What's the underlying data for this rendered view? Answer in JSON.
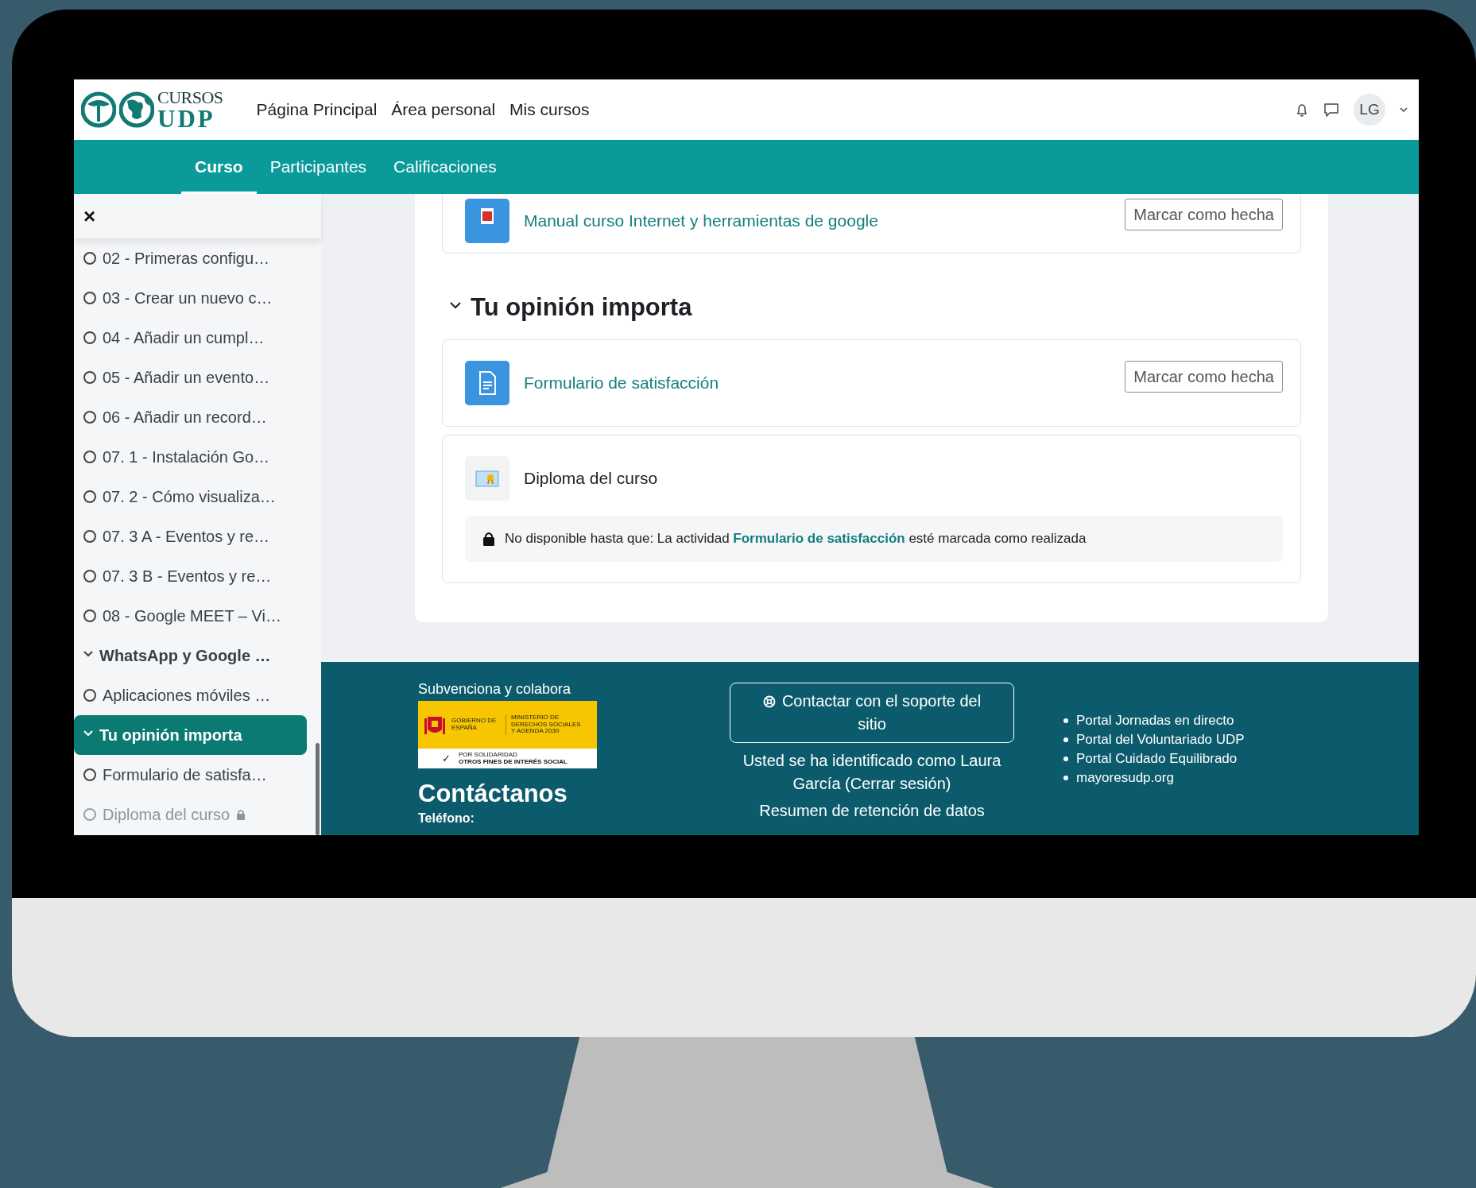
{
  "header": {
    "logo": {
      "line1": "CURSOS",
      "line2": "UDP"
    },
    "nav": [
      {
        "label": "Página Principal"
      },
      {
        "label": "Área personal"
      },
      {
        "label": "Mis cursos"
      }
    ],
    "avatar": "LG"
  },
  "tabs": [
    {
      "label": "Curso",
      "selected": true
    },
    {
      "label": "Participantes",
      "selected": false
    },
    {
      "label": "Calificaciones",
      "selected": false
    }
  ],
  "sidebar": {
    "close": "×",
    "items": [
      {
        "kind": "activity",
        "label": "02 - Primeras configu…",
        "selected": false,
        "disabled": false
      },
      {
        "kind": "activity",
        "label": "03 - Crear un nuevo c…",
        "selected": false,
        "disabled": false
      },
      {
        "kind": "activity",
        "label": "04 - Añadir un cumpl…",
        "selected": false,
        "disabled": false
      },
      {
        "kind": "activity",
        "label": "05 - Añadir un evento…",
        "selected": false,
        "disabled": false
      },
      {
        "kind": "activity",
        "label": "06 - Añadir un record…",
        "selected": false,
        "disabled": false
      },
      {
        "kind": "activity",
        "label": "07. 1 - Instalación Go…",
        "selected": false,
        "disabled": false
      },
      {
        "kind": "activity",
        "label": "07. 2 - Cómo visualiza…",
        "selected": false,
        "disabled": false
      },
      {
        "kind": "activity",
        "label": "07. 3 A - Eventos y re…",
        "selected": false,
        "disabled": false
      },
      {
        "kind": "activity",
        "label": "07. 3 B - Eventos y re…",
        "selected": false,
        "disabled": false
      },
      {
        "kind": "activity",
        "label": "08 - Google MEET – Vi…",
        "selected": false,
        "disabled": false
      },
      {
        "kind": "section",
        "label": "WhatsApp y Google …",
        "selected": false,
        "expanded": true
      },
      {
        "kind": "activity",
        "label": "Aplicaciones móviles …",
        "selected": false,
        "disabled": false
      },
      {
        "kind": "section",
        "label": "Tu opinión importa",
        "selected": true,
        "expanded": true
      },
      {
        "kind": "activity",
        "label": "Formulario de satisfa…",
        "selected": false,
        "disabled": false
      },
      {
        "kind": "activity",
        "label": "Diploma del curso",
        "selected": false,
        "disabled": true
      }
    ]
  },
  "content": {
    "top_cards": [
      {
        "kind": "pdf",
        "title": "Manual curso Internet y herramientas de google",
        "button": "Marcar como hecha"
      }
    ],
    "section": {
      "title": "Tu opinión importa",
      "expanded": true,
      "cards": [
        {
          "kind": "page",
          "title": "Formulario de satisfacción",
          "button": "Marcar como hecha"
        },
        {
          "kind": "certificate",
          "title": "Diploma del curso",
          "restriction": "No disponible hasta que: La actividad **Formulario de satisfacción** esté marcada como realizada"
        }
      ]
    }
  },
  "footer": {
    "sponsor_label": "Subvenciona y colabora",
    "sponsor_logo": {
      "left": "GOBIERNO DE ESPAÑA",
      "right": "MINISTERIO DE DERECHOS SOCIALES Y AGENDA 2030",
      "check": "✓",
      "bottom_small": "POR SOLIDARIDAD",
      "bottom": "OTROS FINES DE INTERÉS SOCIAL"
    },
    "contact_title": "Contáctanos",
    "phone_label": "Teléfono:",
    "support_button": "Contactar con el soporte del sitio",
    "login_info": "Usted se ha identificado como Laura García (Cerrar sesión)",
    "data_retention": "Resumen de retención de datos",
    "links": [
      "Portal Jornadas en directo",
      "Portal del Voluntariado UDP",
      "Portal Cuidado Equilibrado",
      "mayoresudp.org"
    ]
  }
}
